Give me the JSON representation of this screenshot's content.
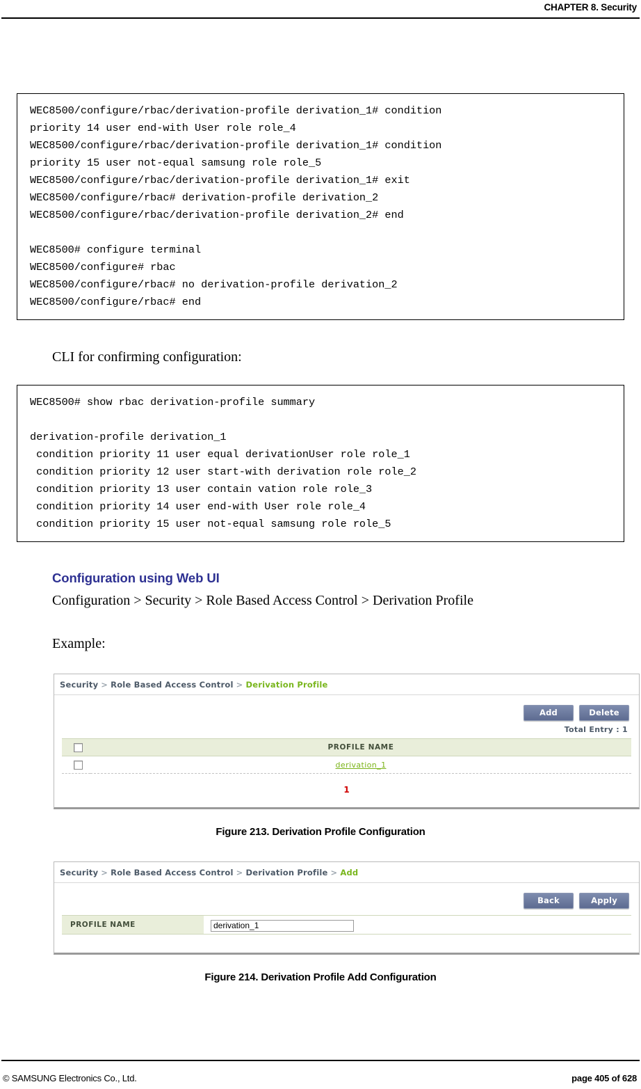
{
  "header": {
    "chapter": "CHAPTER 8. Security"
  },
  "cli_block_1": {
    "lines": [
      "WEC8500/configure/rbac/derivation-profile derivation_1# condition",
      "priority 14 user end-with User role role_4",
      "WEC8500/configure/rbac/derivation-profile derivation_1# condition",
      "priority 15 user not-equal samsung role role_5",
      "WEC8500/configure/rbac/derivation-profile derivation_1# exit",
      "WEC8500/configure/rbac# derivation-profile derivation_2",
      "WEC8500/configure/rbac/derivation-profile derivation_2# end",
      "",
      "WEC8500# configure terminal",
      "WEC8500/configure# rbac",
      "WEC8500/configure/rbac# no derivation-profile derivation_2",
      "WEC8500/configure/rbac# end"
    ]
  },
  "intro_confirm": "CLI for confirming configuration:",
  "cli_block_2": {
    "lines": [
      "WEC8500# show rbac derivation-profile summary",
      "",
      "derivation-profile derivation_1",
      " condition priority 11 user equal derivationUser role role_1",
      " condition priority 12 user start-with derivation role role_2",
      " condition priority 13 user contain vation role role_3",
      " condition priority 14 user end-with User role role_4",
      " condition priority 15 user not-equal samsung role role_5"
    ]
  },
  "section": {
    "heading": "Configuration using Web UI",
    "path": "Configuration > Security > Role Based Access Control > Derivation Profile",
    "example_label": "Example:"
  },
  "figure_213": {
    "caption": "Figure 213. Derivation Profile Configuration",
    "breadcrumb": {
      "crumb1": "Security",
      "crumb2": "Role Based Access Control",
      "crumb3": "Derivation Profile",
      "separator": ">"
    },
    "buttons": {
      "add": "Add",
      "delete": "Delete"
    },
    "total_entry": "Total Entry : 1",
    "table": {
      "columns": [
        "",
        "PROFILE NAME"
      ],
      "rows": [
        {
          "profile_name": "derivation_1"
        }
      ]
    },
    "pager": "1",
    "colors": {
      "accent_green": "#7ab317",
      "header_bg": "#e9eeda",
      "button_bg": "#67759b",
      "pager_red": "#d00000"
    }
  },
  "figure_214": {
    "caption": "Figure 214. Derivation Profile Add Configuration",
    "breadcrumb": {
      "crumb1": "Security",
      "crumb2": "Role Based Access Control",
      "crumb3": "Derivation Profile",
      "crumb4": "Add",
      "separator": ">"
    },
    "buttons": {
      "back": "Back",
      "apply": "Apply"
    },
    "form": {
      "profile_name_label": "PROFILE NAME",
      "profile_name_value": "derivation_1",
      "profile_name_placeholder": ""
    }
  },
  "footer": {
    "copyright": "© SAMSUNG Electronics Co., Ltd.",
    "page": "page 405 of 628"
  }
}
